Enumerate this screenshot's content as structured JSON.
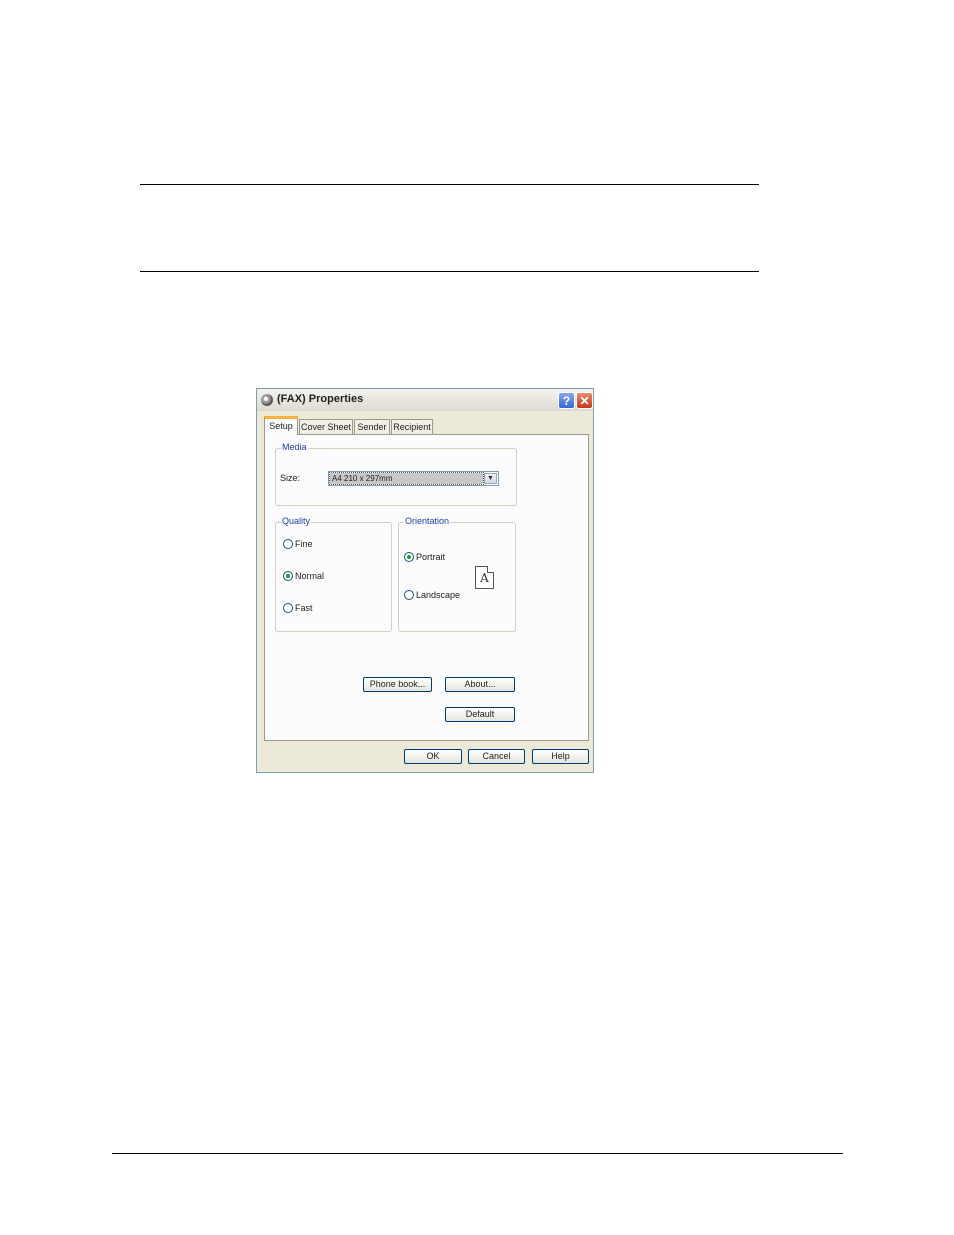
{
  "dialog": {
    "title": "(FAX) Properties",
    "help_label": "?",
    "close_label": "✕"
  },
  "tabs": [
    {
      "label": "Setup",
      "active": true
    },
    {
      "label": "Cover Sheet",
      "active": false
    },
    {
      "label": "Sender",
      "active": false
    },
    {
      "label": "Recipient",
      "active": false
    }
  ],
  "media": {
    "legend": "Media",
    "size_label": "Size:",
    "size_value": "A4 210 x 297mm",
    "dropdown_icon": "chevron-down-icon"
  },
  "quality": {
    "legend": "Quality",
    "options": [
      {
        "label": "Fine",
        "checked": false
      },
      {
        "label": "Normal",
        "checked": true
      },
      {
        "label": "Fast",
        "checked": false
      }
    ]
  },
  "orientation": {
    "legend": "Orientation",
    "options": [
      {
        "label": "Portrait",
        "checked": true
      },
      {
        "label": "Landscape",
        "checked": false
      }
    ],
    "preview_letter": "A"
  },
  "buttons": {
    "phone_book": "Phone book...",
    "about": "About...",
    "default": "Default",
    "ok": "OK",
    "cancel": "Cancel",
    "help": "Help"
  },
  "colors": {
    "dialog_bg": "#ece9d8",
    "active_tab_accent": "#f6b33f",
    "group_legend": "#1b3ea8",
    "radio_dot": "#21a121"
  }
}
